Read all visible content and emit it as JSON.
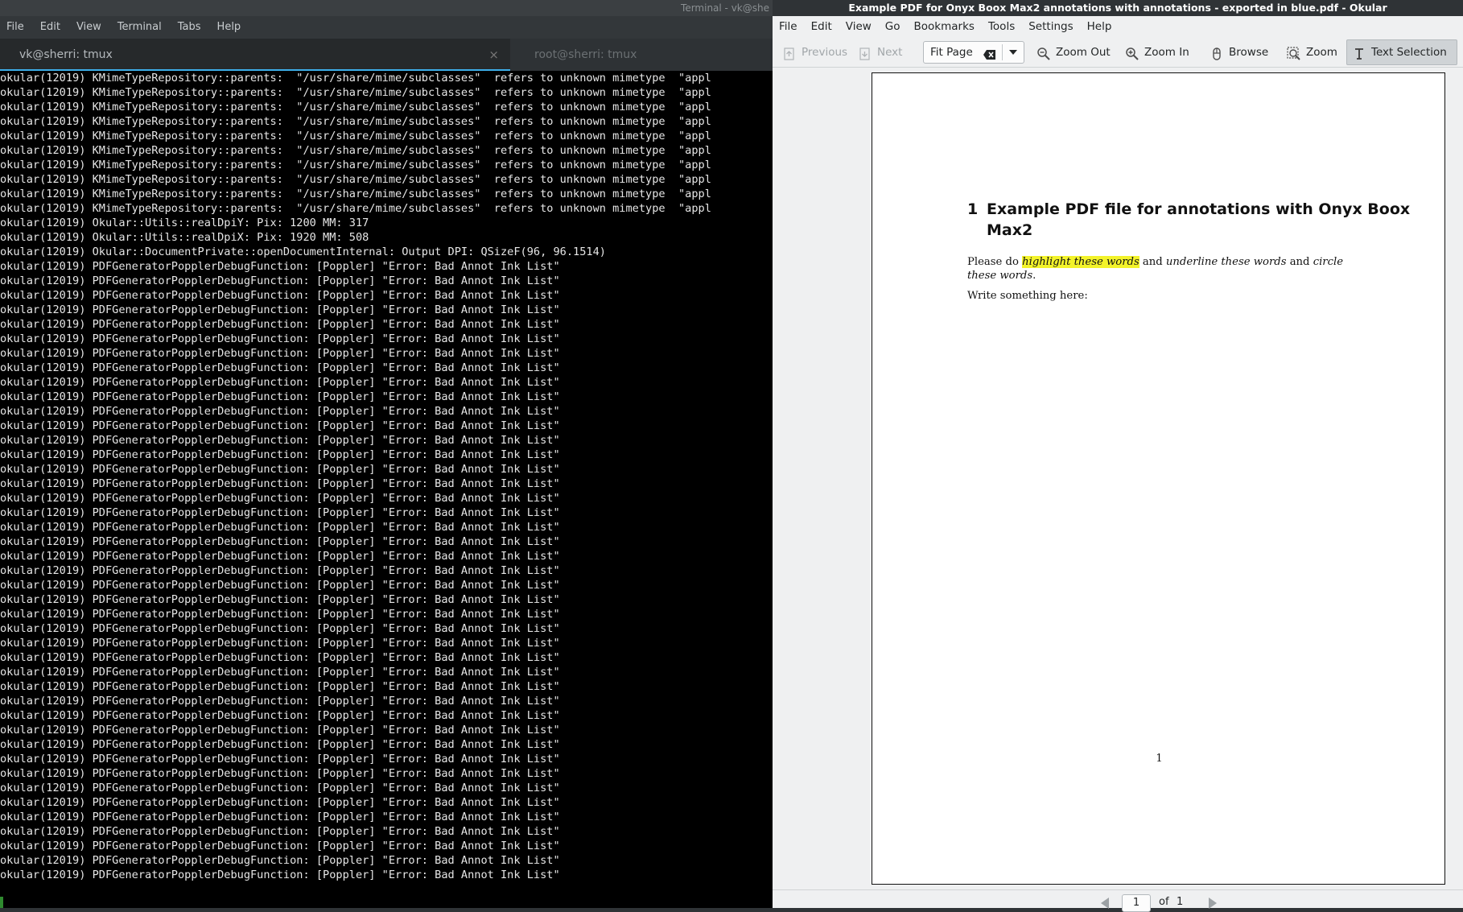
{
  "terminal": {
    "title": "Terminal - vk@she",
    "menu": [
      "File",
      "Edit",
      "View",
      "Terminal",
      "Tabs",
      "Help"
    ],
    "tabs": [
      {
        "label": "vk@sherri: tmux",
        "active": true
      },
      {
        "label": "root@sherri: tmux",
        "active": false
      }
    ],
    "tab_close_symbol": "×",
    "lines": [
      "okular(12019) KMimeTypeRepository::parents:  \"/usr/share/mime/subclasses\"  refers to unknown mimetype  \"appl",
      "okular(12019) KMimeTypeRepository::parents:  \"/usr/share/mime/subclasses\"  refers to unknown mimetype  \"appl",
      "okular(12019) KMimeTypeRepository::parents:  \"/usr/share/mime/subclasses\"  refers to unknown mimetype  \"appl",
      "okular(12019) KMimeTypeRepository::parents:  \"/usr/share/mime/subclasses\"  refers to unknown mimetype  \"appl",
      "okular(12019) KMimeTypeRepository::parents:  \"/usr/share/mime/subclasses\"  refers to unknown mimetype  \"appl",
      "okular(12019) KMimeTypeRepository::parents:  \"/usr/share/mime/subclasses\"  refers to unknown mimetype  \"appl",
      "okular(12019) KMimeTypeRepository::parents:  \"/usr/share/mime/subclasses\"  refers to unknown mimetype  \"appl",
      "okular(12019) KMimeTypeRepository::parents:  \"/usr/share/mime/subclasses\"  refers to unknown mimetype  \"appl",
      "okular(12019) KMimeTypeRepository::parents:  \"/usr/share/mime/subclasses\"  refers to unknown mimetype  \"appl",
      "okular(12019) KMimeTypeRepository::parents:  \"/usr/share/mime/subclasses\"  refers to unknown mimetype  \"appl",
      "okular(12019) Okular::Utils::realDpiY: Pix: 1200 MM: 317",
      "okular(12019) Okular::Utils::realDpiX: Pix: 1920 MM: 508",
      "okular(12019) Okular::DocumentPrivate::openDocumentInternal: Output DPI: QSizeF(96, 96.1514)",
      "okular(12019) PDFGeneratorPopplerDebugFunction: [Poppler] \"Error: Bad Annot Ink List\"",
      "okular(12019) PDFGeneratorPopplerDebugFunction: [Poppler] \"Error: Bad Annot Ink List\"",
      "okular(12019) PDFGeneratorPopplerDebugFunction: [Poppler] \"Error: Bad Annot Ink List\"",
      "okular(12019) PDFGeneratorPopplerDebugFunction: [Poppler] \"Error: Bad Annot Ink List\"",
      "okular(12019) PDFGeneratorPopplerDebugFunction: [Poppler] \"Error: Bad Annot Ink List\"",
      "okular(12019) PDFGeneratorPopplerDebugFunction: [Poppler] \"Error: Bad Annot Ink List\"",
      "okular(12019) PDFGeneratorPopplerDebugFunction: [Poppler] \"Error: Bad Annot Ink List\"",
      "okular(12019) PDFGeneratorPopplerDebugFunction: [Poppler] \"Error: Bad Annot Ink List\"",
      "okular(12019) PDFGeneratorPopplerDebugFunction: [Poppler] \"Error: Bad Annot Ink List\"",
      "okular(12019) PDFGeneratorPopplerDebugFunction: [Poppler] \"Error: Bad Annot Ink List\"",
      "okular(12019) PDFGeneratorPopplerDebugFunction: [Poppler] \"Error: Bad Annot Ink List\"",
      "okular(12019) PDFGeneratorPopplerDebugFunction: [Poppler] \"Error: Bad Annot Ink List\"",
      "okular(12019) PDFGeneratorPopplerDebugFunction: [Poppler] \"Error: Bad Annot Ink List\"",
      "okular(12019) PDFGeneratorPopplerDebugFunction: [Poppler] \"Error: Bad Annot Ink List\"",
      "okular(12019) PDFGeneratorPopplerDebugFunction: [Poppler] \"Error: Bad Annot Ink List\"",
      "okular(12019) PDFGeneratorPopplerDebugFunction: [Poppler] \"Error: Bad Annot Ink List\"",
      "okular(12019) PDFGeneratorPopplerDebugFunction: [Poppler] \"Error: Bad Annot Ink List\"",
      "okular(12019) PDFGeneratorPopplerDebugFunction: [Poppler] \"Error: Bad Annot Ink List\"",
      "okular(12019) PDFGeneratorPopplerDebugFunction: [Poppler] \"Error: Bad Annot Ink List\"",
      "okular(12019) PDFGeneratorPopplerDebugFunction: [Poppler] \"Error: Bad Annot Ink List\"",
      "okular(12019) PDFGeneratorPopplerDebugFunction: [Poppler] \"Error: Bad Annot Ink List\"",
      "okular(12019) PDFGeneratorPopplerDebugFunction: [Poppler] \"Error: Bad Annot Ink List\"",
      "okular(12019) PDFGeneratorPopplerDebugFunction: [Poppler] \"Error: Bad Annot Ink List\"",
      "okular(12019) PDFGeneratorPopplerDebugFunction: [Poppler] \"Error: Bad Annot Ink List\"",
      "okular(12019) PDFGeneratorPopplerDebugFunction: [Poppler] \"Error: Bad Annot Ink List\"",
      "okular(12019) PDFGeneratorPopplerDebugFunction: [Poppler] \"Error: Bad Annot Ink List\"",
      "okular(12019) PDFGeneratorPopplerDebugFunction: [Poppler] \"Error: Bad Annot Ink List\"",
      "okular(12019) PDFGeneratorPopplerDebugFunction: [Poppler] \"Error: Bad Annot Ink List\"",
      "okular(12019) PDFGeneratorPopplerDebugFunction: [Poppler] \"Error: Bad Annot Ink List\"",
      "okular(12019) PDFGeneratorPopplerDebugFunction: [Poppler] \"Error: Bad Annot Ink List\"",
      "okular(12019) PDFGeneratorPopplerDebugFunction: [Poppler] \"Error: Bad Annot Ink List\"",
      "okular(12019) PDFGeneratorPopplerDebugFunction: [Poppler] \"Error: Bad Annot Ink List\"",
      "okular(12019) PDFGeneratorPopplerDebugFunction: [Poppler] \"Error: Bad Annot Ink List\"",
      "okular(12019) PDFGeneratorPopplerDebugFunction: [Poppler] \"Error: Bad Annot Ink List\"",
      "okular(12019) PDFGeneratorPopplerDebugFunction: [Poppler] \"Error: Bad Annot Ink List\"",
      "okular(12019) PDFGeneratorPopplerDebugFunction: [Poppler] \"Error: Bad Annot Ink List\"",
      "okular(12019) PDFGeneratorPopplerDebugFunction: [Poppler] \"Error: Bad Annot Ink List\"",
      "okular(12019) PDFGeneratorPopplerDebugFunction: [Poppler] \"Error: Bad Annot Ink List\"",
      "okular(12019) PDFGeneratorPopplerDebugFunction: [Poppler] \"Error: Bad Annot Ink List\"",
      "okular(12019) PDFGeneratorPopplerDebugFunction: [Poppler] \"Error: Bad Annot Ink List\"",
      "okular(12019) PDFGeneratorPopplerDebugFunction: [Poppler] \"Error: Bad Annot Ink List\"",
      "okular(12019) PDFGeneratorPopplerDebugFunction: [Poppler] \"Error: Bad Annot Ink List\"",
      "okular(12019) PDFGeneratorPopplerDebugFunction: [Poppler] \"Error: Bad Annot Ink List\""
    ]
  },
  "okular": {
    "title": "Example PDF for Onyx Boox Max2 annotations with annotations - exported in blue.pdf - Okular",
    "menu": [
      "File",
      "Edit",
      "View",
      "Go",
      "Bookmarks",
      "Tools",
      "Settings",
      "Help"
    ],
    "toolbar": {
      "previous_label": "Previous",
      "next_label": "Next",
      "zoom_value": "Fit Page",
      "zoom_out_label": "Zoom Out",
      "zoom_in_label": "Zoom In",
      "browse_label": "Browse",
      "zoom_label": "Zoom",
      "text_selection_label": "Text Selection"
    },
    "document": {
      "heading_number": "1",
      "heading_text": "Example PDF file for annotations with Onyx Boox Max2",
      "para_prefix": "Please do ",
      "para_highlight": "highlight these words",
      "para_and1": " and ",
      "para_underline": "underline these words",
      "para_and2": " and ",
      "para_circle": "circle these words",
      "para_end": ".",
      "write_text": "Write something here:",
      "page_number_footer": "1",
      "highlight_color": "#f3f32a"
    },
    "pager": {
      "current_page": "1",
      "of_label": "of",
      "total_pages": "1"
    }
  }
}
